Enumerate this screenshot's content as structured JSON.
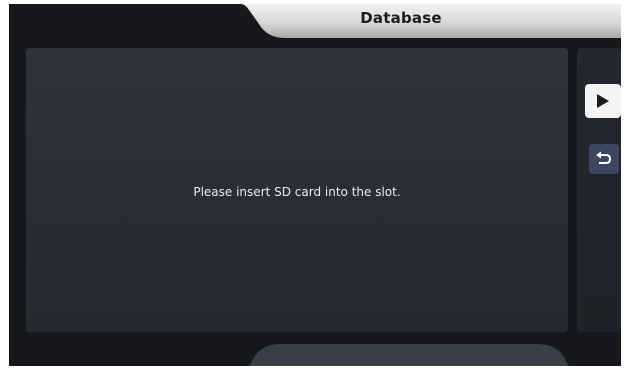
{
  "header": {
    "title": "Database"
  },
  "main": {
    "message": "Please insert SD card into the slot."
  },
  "sidebar": {
    "buttons": [
      {
        "icon": "play-icon"
      },
      {
        "icon": "return-icon"
      }
    ]
  }
}
